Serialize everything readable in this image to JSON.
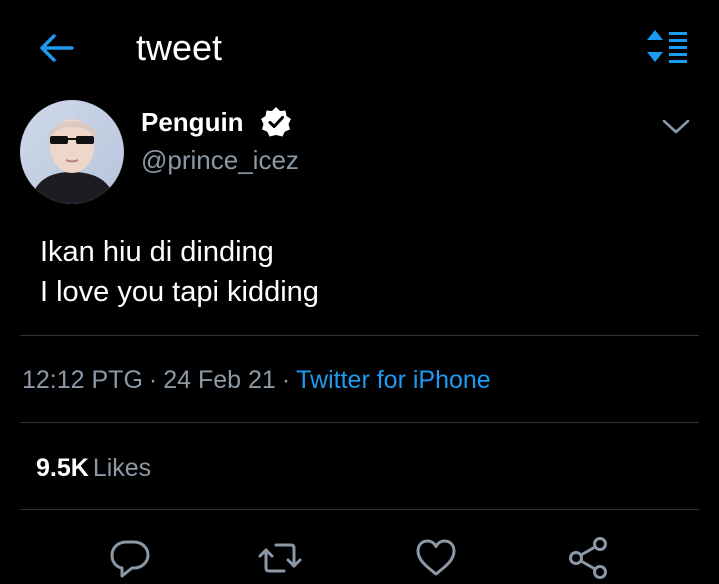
{
  "header": {
    "title": "tweet",
    "back_icon": "back-arrow-icon",
    "sort_icon": "sort-icon",
    "accent_color": "#1d9bf0"
  },
  "tweet": {
    "author": {
      "name": "Penguin",
      "handle": "@prince_icez",
      "verified": true
    },
    "text_lines": [
      "Ikan hiu di dinding",
      "I love you tapi kidding"
    ],
    "time": "12:12 PTG",
    "date": "24 Feb 21",
    "source": "Twitter for iPhone",
    "separator": "·",
    "likes_count": "9.5K",
    "likes_label": "Likes"
  },
  "actions": [
    {
      "icon": "reply-icon"
    },
    {
      "icon": "retweet-icon"
    },
    {
      "icon": "like-icon"
    },
    {
      "icon": "share-icon"
    }
  ],
  "colors": {
    "background": "#000000",
    "primary_text": "#ffffff",
    "secondary_text": "#8b98a5",
    "link": "#1d9bf0",
    "divider": "#2f3336"
  }
}
